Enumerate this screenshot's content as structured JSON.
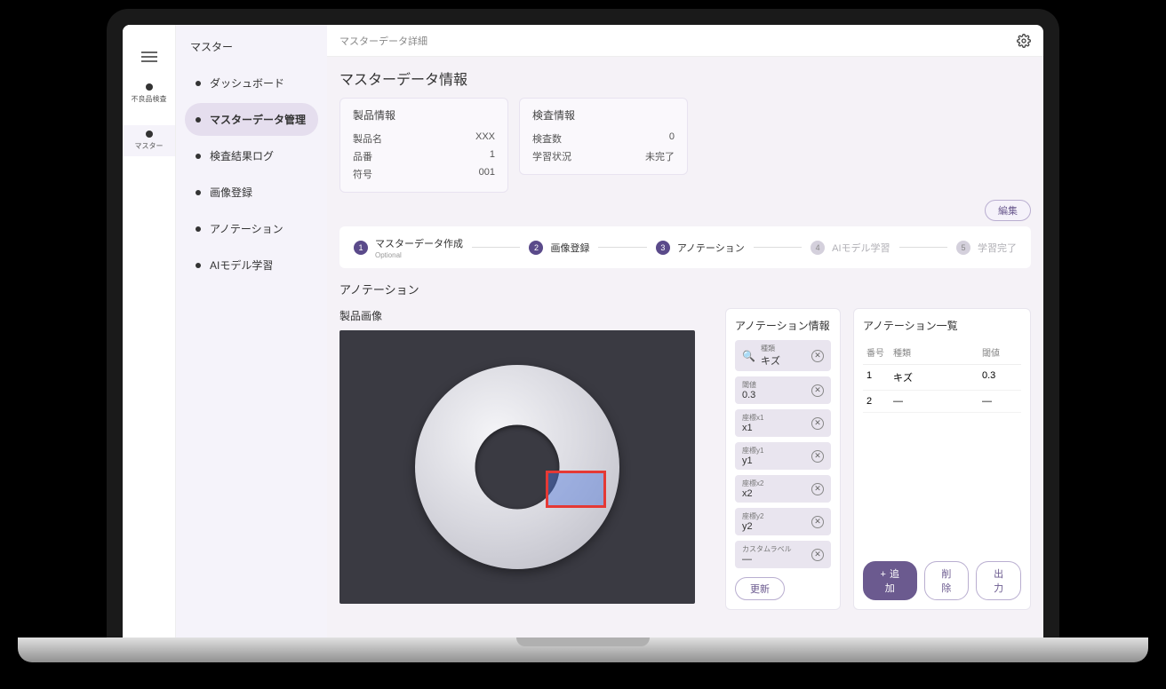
{
  "rail": {
    "items": [
      {
        "label": "不良品検査"
      },
      {
        "label": "マスター"
      }
    ]
  },
  "sidebar": {
    "title": "マスター",
    "items": [
      {
        "label": "ダッシュボード"
      },
      {
        "label": "マスターデータ管理"
      },
      {
        "label": "検査結果ログ"
      },
      {
        "label": "画像登録"
      },
      {
        "label": "アノテーション"
      },
      {
        "label": "AIモデル学習"
      }
    ]
  },
  "breadcrumb": "マスターデータ詳細",
  "page_title": "マスターデータ情報",
  "product_card": {
    "title": "製品情報",
    "rows": [
      {
        "k": "製品名",
        "v": "XXX"
      },
      {
        "k": "品番",
        "v": "1"
      },
      {
        "k": "符号",
        "v": "001"
      }
    ]
  },
  "inspect_card": {
    "title": "検査情報",
    "rows": [
      {
        "k": "検査数",
        "v": "0"
      },
      {
        "k": "学習状況",
        "v": "未完了"
      }
    ]
  },
  "edit_label": "編集",
  "steps": [
    {
      "label": "マスターデータ作成",
      "sub": "Optional",
      "active": true
    },
    {
      "label": "画像登録",
      "active": true
    },
    {
      "label": "アノテーション",
      "active": true
    },
    {
      "label": "AIモデル学習",
      "active": false
    },
    {
      "label": "学習完了",
      "active": false
    }
  ],
  "section_title": "アノテーション",
  "image_title": "製品画像",
  "annotation_info": {
    "title": "アノテーション情報",
    "fields": [
      {
        "label": "種類",
        "value": "キズ",
        "search": true
      },
      {
        "label": "閾値",
        "value": "0.3"
      },
      {
        "label": "座標x1",
        "value": "x1"
      },
      {
        "label": "座標y1",
        "value": "y1"
      },
      {
        "label": "座標x2",
        "value": "x2"
      },
      {
        "label": "座標y2",
        "value": "y2"
      },
      {
        "label": "カスタムラベル",
        "value": "—"
      }
    ],
    "update_label": "更新"
  },
  "annotation_list": {
    "title": "アノテーション一覧",
    "headers": {
      "no": "番号",
      "type": "種類",
      "threshold": "閾値"
    },
    "rows": [
      {
        "no": "1",
        "type": "キズ",
        "threshold": "0.3"
      },
      {
        "no": "2",
        "type": "—",
        "threshold": "—"
      }
    ],
    "add_label": "追加",
    "delete_label": "削除",
    "export_label": "出力"
  }
}
